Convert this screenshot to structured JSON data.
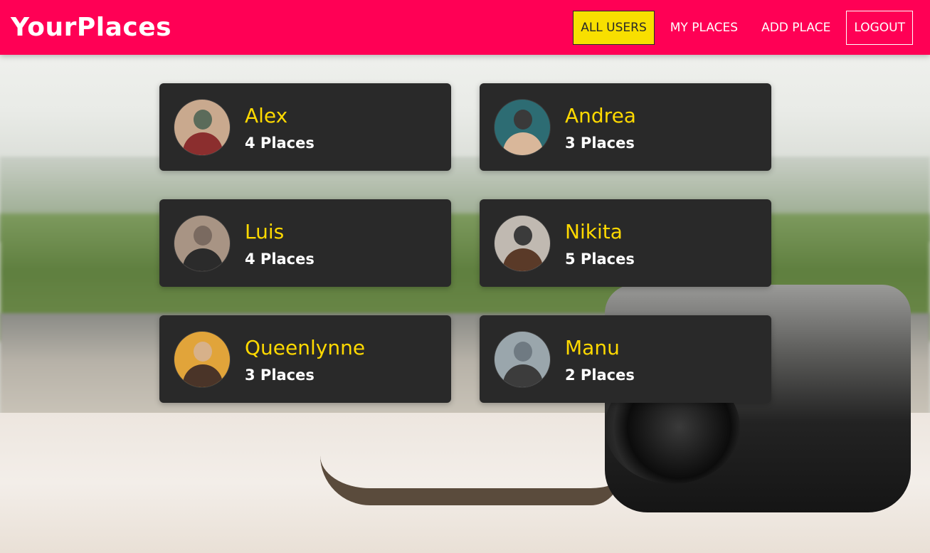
{
  "app": {
    "title": "YourPlaces"
  },
  "nav": [
    {
      "label": "ALL USERS",
      "active": true
    },
    {
      "label": "MY PLACES"
    },
    {
      "label": "ADD PLACE"
    },
    {
      "label": "LOGOUT"
    }
  ],
  "colors": {
    "header": "#ff0055",
    "active_nav": "#f8df00",
    "card": "#292929",
    "name": "#ffd900",
    "count": "#ffffff"
  },
  "users": [
    {
      "name": "Alex",
      "places": "4 Places",
      "avatar_colors": [
        "#c9a98e",
        "#8b2e2e",
        "#5b6b5a"
      ]
    },
    {
      "name": "Andrea",
      "places": "3 Places",
      "avatar_colors": [
        "#2d6c73",
        "#d9b79a",
        "#3a3a3a"
      ]
    },
    {
      "name": "Luis",
      "places": "4 Places",
      "avatar_colors": [
        "#a89484",
        "#2b2b2b",
        "#7a6a60"
      ]
    },
    {
      "name": "Nikita",
      "places": "5 Places",
      "avatar_colors": [
        "#c0b9b1",
        "#5a3a28",
        "#3b3b3b"
      ]
    },
    {
      "name": "Queenlynne",
      "places": "3 Places",
      "avatar_colors": [
        "#e1a43a",
        "#4a3428",
        "#d7b18a"
      ]
    },
    {
      "name": "Manu",
      "places": "2 Places",
      "avatar_colors": [
        "#9aa6ac",
        "#3c3c3c",
        "#6f7a82"
      ]
    }
  ]
}
